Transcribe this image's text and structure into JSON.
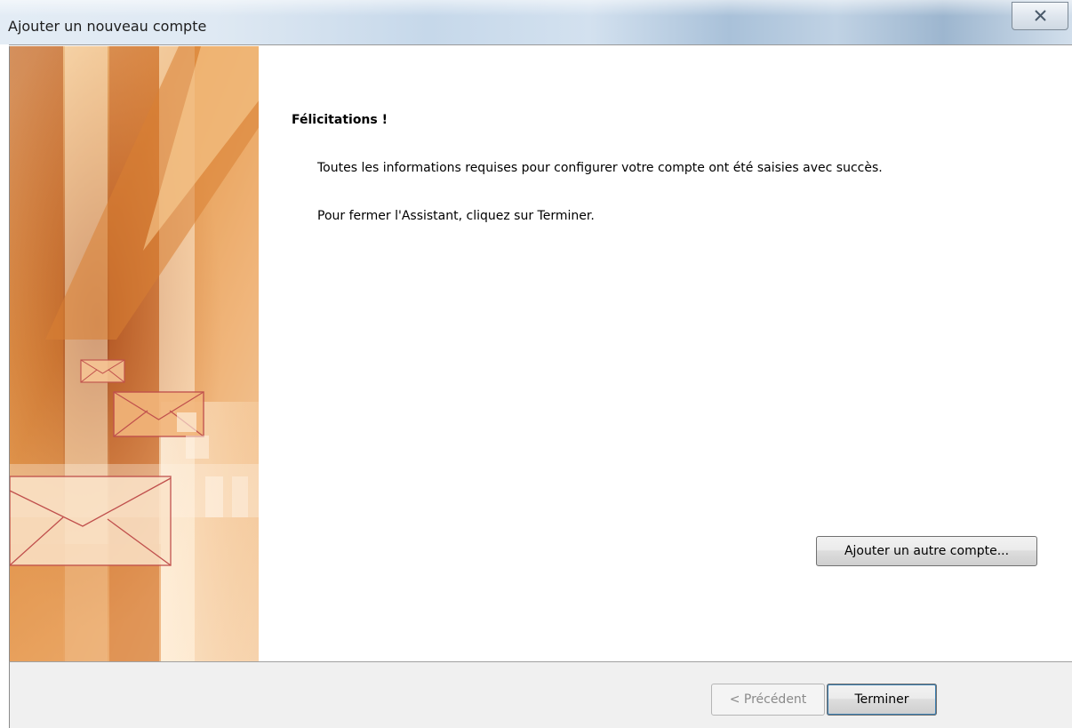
{
  "window": {
    "title": "Ajouter un nouveau compte"
  },
  "content": {
    "heading": "Félicitations !",
    "message_1": "Toutes les informations requises pour configurer votre compte ont été saisies avec succès.",
    "message_2": "Pour fermer l'Assistant, cliquez sur Terminer.",
    "add_account_label": "Ajouter un autre compte..."
  },
  "footer": {
    "previous_label": "< Précédent",
    "previous_enabled": false,
    "finish_label": "Terminer"
  },
  "colors": {
    "banner_orange": "#d4802f",
    "banner_dark": "#a9471d",
    "envelope_line": "#c0504d",
    "focus_border": "#3c7fb1"
  },
  "icons": {
    "close": "close-icon",
    "envelopes": "envelope-icon"
  }
}
